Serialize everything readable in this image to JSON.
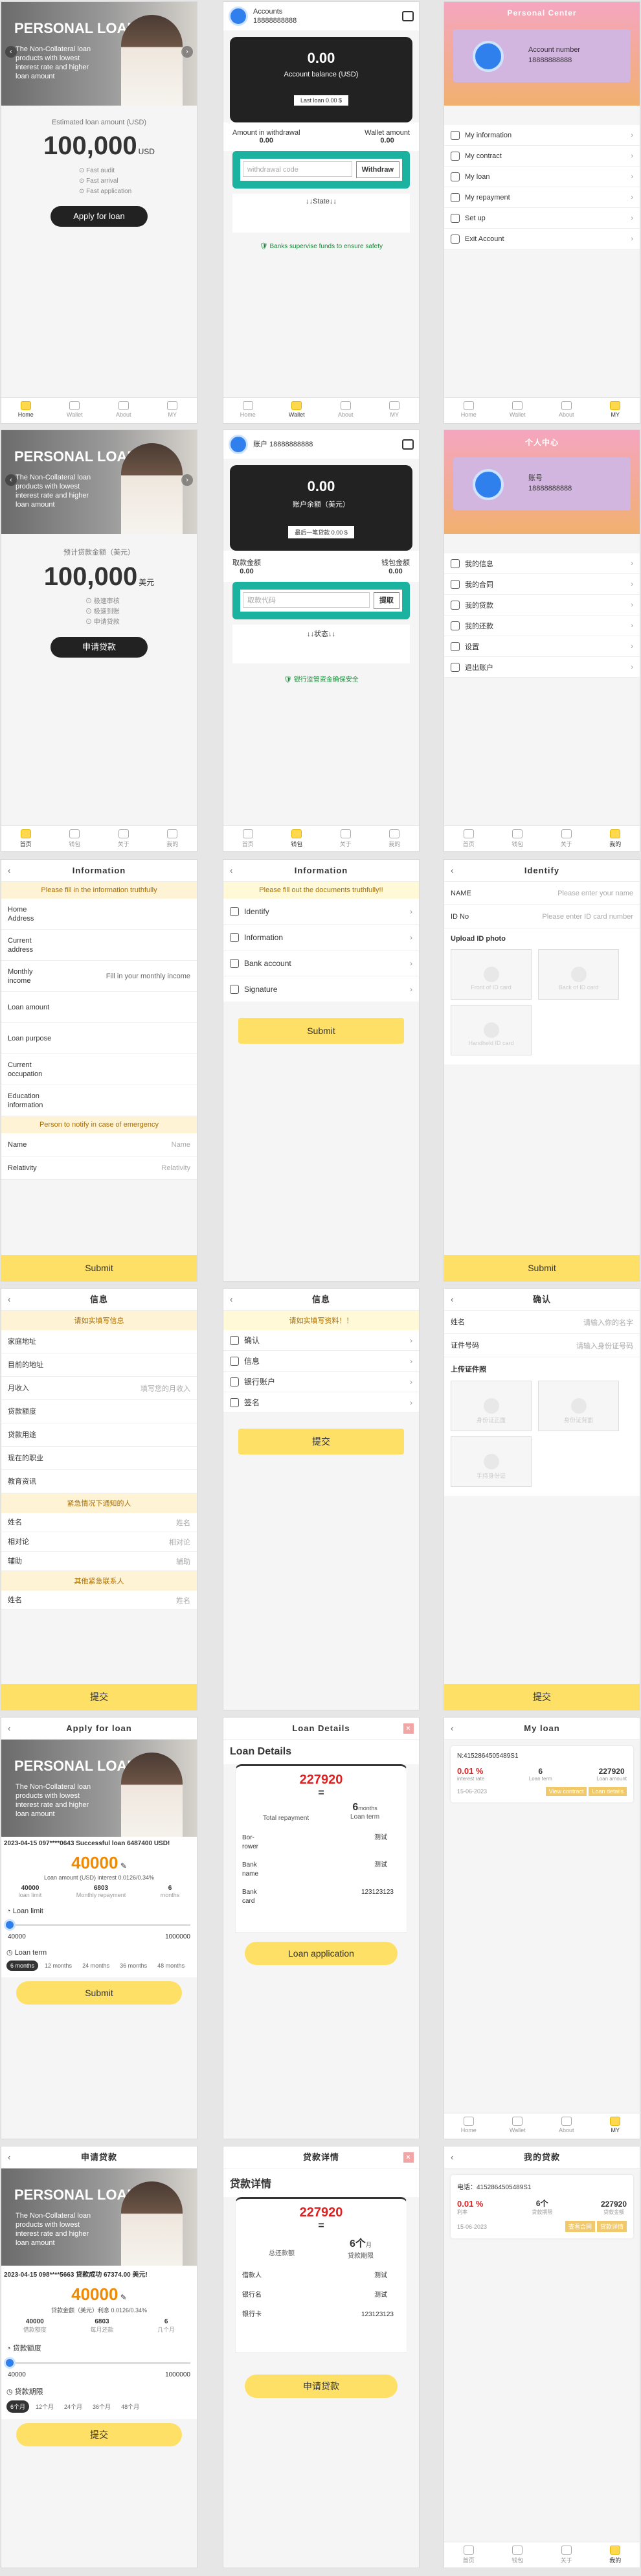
{
  "home_en": {
    "banner_title": "PERSONAL LOAN",
    "banner_sub": "The Non-Collateral loan products with lowest interest rate and higher loan amount",
    "est_label": "Estimated loan amount (USD)",
    "amount": "100,000",
    "unit": "USD",
    "feat": [
      "Fast audit",
      "Fast arrival",
      "Fast application"
    ],
    "apply": "Apply for loan"
  },
  "home_cn": {
    "banner_title": "PERSONAL LOAN",
    "banner_sub": "The Non-Collateral loan products with lowest interest rate and higher loan amount",
    "est_label": "预计贷款金额（美元）",
    "amount": "100,000",
    "unit": "美元",
    "feat": [
      "极速审核",
      "极速到账",
      "申请贷款"
    ],
    "apply": "申请贷款"
  },
  "tabs_en": [
    "Home",
    "Wallet",
    "About",
    "MY"
  ],
  "tabs_cn": [
    "首页",
    "钱包",
    "关于",
    "我的"
  ],
  "wallet_en": {
    "accounts": "Accounts",
    "phone": "18888888888",
    "balance": "0.00",
    "bal_label": "Account balance (USD)",
    "last": "Last loan 0.00 $",
    "aw_label": "Amount in withdrawal",
    "aw": "0.00",
    "wa_label": "Wallet amount",
    "wa": "0.00",
    "code_ph": "withdrawal code",
    "withdraw": "Withdraw",
    "state": "↓↓State↓↓",
    "safe": "Banks supervise funds to ensure safety"
  },
  "wallet_cn": {
    "accounts": "账户 18888888888",
    "balance": "0.00",
    "bal_label": "账户余额（美元）",
    "last": "最后一笔贷款 0.00 $",
    "aw_label": "取款金额",
    "aw": "0.00",
    "wa_label": "钱包金额",
    "wa": "0.00",
    "code_ph": "取款代码",
    "withdraw": "提取",
    "state": "↓↓状态↓↓",
    "safe": "银行监管资金确保安全"
  },
  "pc_en": {
    "title": "Personal Center",
    "acc_label": "Account number",
    "acc": "18888888888",
    "items": [
      "My information",
      "My contract",
      "My loan",
      "My repayment",
      "Set up",
      "Exit Account"
    ]
  },
  "pc_cn": {
    "title": "个人中心",
    "acc_label": "账号",
    "acc": "18888888888",
    "items": [
      "我的信息",
      "我的合同",
      "我的贷款",
      "我的还款",
      "设置",
      "退出账户"
    ]
  },
  "info_en": {
    "title": "Information",
    "notice": "Please fill in the information truthfully",
    "fields": [
      "Home Address",
      "Current address",
      "Monthly income",
      "Loan amount",
      "Loan purpose",
      "Current occupation",
      "Education information"
    ],
    "income_ph": "Fill in your monthly income",
    "emergency": "Person to notify in case of emergency",
    "name": "Name",
    "name_ph": "Name",
    "rel": "Relativity",
    "rel_ph": "Relativity",
    "submit": "Submit"
  },
  "info_cn": {
    "title": "信息",
    "notice": "请如实填写信息",
    "fields": [
      "家庭地址",
      "目前的地址",
      "月收入",
      "贷款额度",
      "贷款用途",
      "现在的职业",
      "教育资讯"
    ],
    "income_ph": "填写您的月收入",
    "emergency": "紧急情况下通知的人",
    "name": "姓名",
    "name_ph": "姓名",
    "rel": "相对论",
    "rel_ph": "相对论",
    "rel2": "辅助",
    "other": "其他紧急联系人",
    "submit": "提交"
  },
  "docs_en": {
    "title": "Information",
    "notice": "Please fill out the documents truthfully!!",
    "items": [
      "Identify",
      "Information",
      "Bank account",
      "Signature"
    ],
    "submit": "Submit"
  },
  "docs_cn": {
    "title": "信息",
    "notice": "请如实填写资料！！",
    "items": [
      "确认",
      "信息",
      "银行账户",
      "签名"
    ],
    "submit": "提交"
  },
  "id_en": {
    "title": "Identify",
    "name": "NAME",
    "name_ph": "Please enter your name",
    "idno": "ID No",
    "id_ph": "Please enter ID card number",
    "upload": "Upload ID photo",
    "boxes": [
      "Front of ID card",
      "Back of ID card",
      "Handheld ID card"
    ],
    "submit": "Submit"
  },
  "id_cn": {
    "title": "确认",
    "name": "姓名",
    "name_ph": "请输入你的名字",
    "idno": "证件号码",
    "id_ph": "请输入身份证号码",
    "upload": "上传证件照",
    "boxes": [
      "身份证正面",
      "身份证背面",
      "手持身份证"
    ],
    "submit": "提交"
  },
  "apply_en": {
    "title": "Apply for loan",
    "ticker": "2023-04-15 097****0643 Successful loan 6487400 USD!",
    "amount": "40000",
    "note": "Loan amount (USD) interest 0.0126/0.34%",
    "m1": "40000",
    "m1l": "loan limit",
    "m2": "6803",
    "m2l": "Monthly repayment",
    "m3": "6",
    "m3l": "months",
    "limit": "Loan limit",
    "min": "40000",
    "max": "1000000",
    "term": "Loan term",
    "terms": [
      "6 months",
      "12 months",
      "24 months",
      "36 months",
      "48 months"
    ],
    "submit": "Submit"
  },
  "apply_cn": {
    "title": "申请贷款",
    "ticker": "2023-04-15 098****5663 贷款成功 67374.00 美元!",
    "amount": "40000",
    "note": "贷款金额（美元）利息 0.0126/0.34%",
    "m1": "40000",
    "m1l": "借款额度",
    "m2": "6803",
    "m2l": "每月还款",
    "m3": "6",
    "m3l": "几个月",
    "limit": "贷款额度",
    "min": "40000",
    "max": "1000000",
    "term": "贷款期限",
    "terms": [
      "6个月",
      "12个月",
      "24个月",
      "36个月",
      "48个月"
    ],
    "submit": "提交"
  },
  "detail_en": {
    "title": "Loan Details",
    "h": "Loan Details",
    "total": "227920",
    "eq": "=",
    "months": "6",
    "mu": "months",
    "tr": "Total repayment",
    "lt": "Loan term",
    "rows": [
      [
        "Bor-rower",
        "测试"
      ],
      [
        "Bank name",
        "测试"
      ],
      [
        "Bank card",
        "123123123"
      ]
    ],
    "btn": "Loan application"
  },
  "detail_cn": {
    "title": "贷款详情",
    "h": "贷款详情",
    "total": "227920",
    "eq": "=",
    "months": "6个",
    "mu": "月",
    "tr": "总还款额",
    "lt": "贷款期限",
    "rows": [
      [
        "借款人",
        "测试"
      ],
      [
        "银行名",
        "测试"
      ],
      [
        "银行卡",
        "123123123"
      ]
    ],
    "btn": "申请贷款"
  },
  "myloan_en": {
    "title": "My loan",
    "no": "N:4152864505489S1",
    "rate": "0.01 %",
    "months": "6",
    "total": "227920",
    "rl": "interest rate",
    "tl": "Loan amount",
    "ml": "Loan term",
    "date": "15-06-2023",
    "t1": "View contract",
    "t2": "Loan details"
  },
  "myloan_cn": {
    "title": "我的贷款",
    "no": "电话：4152864505489S1",
    "rate": "0.01 %",
    "months": "6个",
    "total": "227920",
    "rl": "利率",
    "tl": "贷款金额",
    "ml": "贷款期限",
    "date": "15-06-2023",
    "t1": "查看合同",
    "t2": "贷款详情"
  },
  "colors": {
    "accent": "#ffe066",
    "teal": "#1bb3a0",
    "red": "#e02020",
    "orange": "#f08a00"
  }
}
